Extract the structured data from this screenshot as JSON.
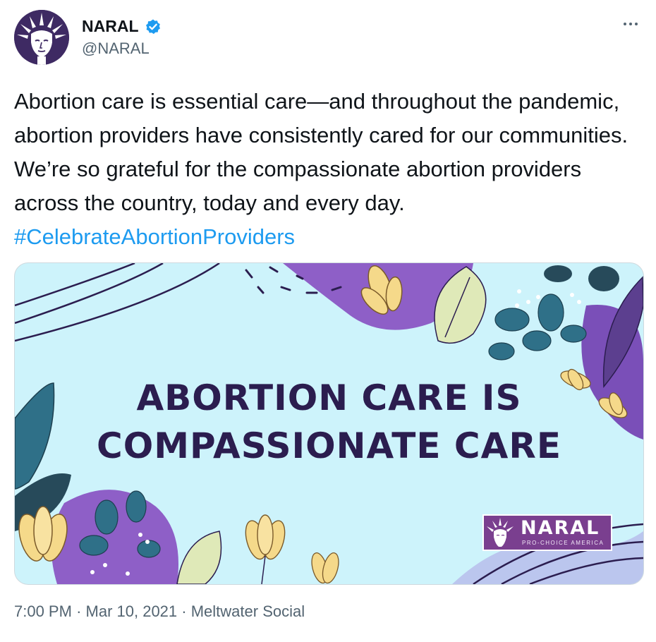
{
  "author": {
    "display_name": "NARAL",
    "handle": "@NARAL",
    "verified": true,
    "avatar_icon": "statue-of-liberty-logo-icon"
  },
  "tweet": {
    "text": "Abortion care is essential care—and throughout the pandemic, abortion providers have consistently cared for our communities. We’re so grateful for the compassionate abortion providers across the country, today and every day. ",
    "hashtag": "#CelebrateAbortionProviders"
  },
  "media": {
    "headline_line1": "ABORTION CARE IS",
    "headline_line2": "COMPASSIONATE CARE",
    "logo_name": "NARAL",
    "logo_tagline": "PRO-CHOICE AMERICA"
  },
  "meta": {
    "time": "7:00 PM",
    "separator": "·",
    "date": "Mar 10, 2021",
    "source": "Meltwater Social"
  },
  "colors": {
    "hashtag": "#1d9bf0",
    "verified": "#1d9bf0",
    "media_bg": "#cdf3fb",
    "headline": "#2b1d4f",
    "brand_purple": "#7a3f8f"
  }
}
